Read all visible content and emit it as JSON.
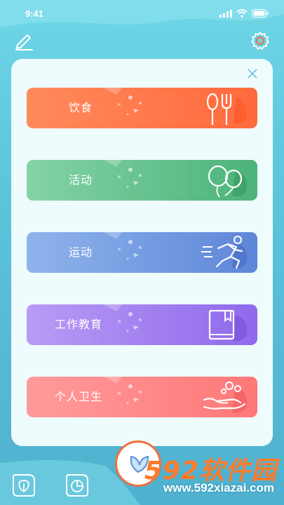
{
  "status_bar": {
    "time": "9:41"
  },
  "categories": [
    {
      "label": "饮食",
      "icon": "fork-spoon-icon",
      "color_from": "#ff8a5c",
      "color_to": "#ff6a3d"
    },
    {
      "label": "活动",
      "icon": "balloons-icon",
      "color_from": "#84d3a6",
      "color_to": "#4cb37a"
    },
    {
      "label": "运动",
      "icon": "running-person-icon",
      "color_from": "#8fb4ec",
      "color_to": "#5e86d8"
    },
    {
      "label": "工作教育",
      "icon": "book-icon",
      "color_from": "#b89bf5",
      "color_to": "#8f69ec"
    },
    {
      "label": "个人卫生",
      "icon": "washing-hands-icon",
      "color_from": "#ff9b9b",
      "color_to": "#ff7878"
    }
  ],
  "watermark": {
    "brand": "592软件园",
    "url": "www.592xiazai.com"
  },
  "colors": {
    "card_bg": "#eefcfd",
    "accent": "#2d8fb0",
    "nav_orange": "#f07040"
  }
}
